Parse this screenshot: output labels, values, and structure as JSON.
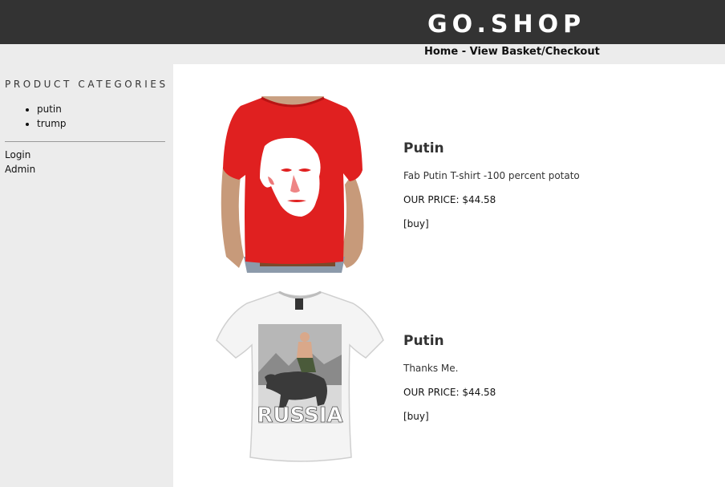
{
  "site": {
    "title": "GO.SHOP"
  },
  "nav": {
    "home": "Home",
    "separator": " - ",
    "basket": "View Basket/Checkout"
  },
  "sidebar": {
    "heading": "PRODUCT CATEGORIES",
    "categories": [
      "putin",
      "trump"
    ],
    "login": "Login",
    "admin": "Admin"
  },
  "products": [
    {
      "name": "Putin",
      "description": "Fab Putin T-shirt -100 percent potato",
      "price": "OUR PRICE: $44.58",
      "buy": "[buy]",
      "image": "red-tshirt-putin-face-image"
    },
    {
      "name": "Putin",
      "description": "Thanks Me.",
      "price": "OUR PRICE: $44.58",
      "buy": "[buy]",
      "image": "white-tshirt-putin-bear-russia-image",
      "image_text": "RUSSIA"
    }
  ],
  "colors": {
    "header_bg": "#333333",
    "sidebar_bg": "#ececec",
    "main_bg": "#ffffff",
    "shirt_red": "#e02020"
  }
}
